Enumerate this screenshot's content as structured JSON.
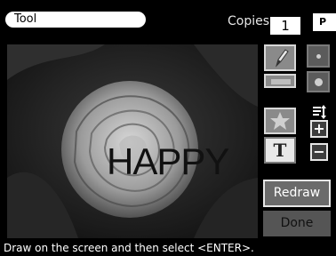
{
  "header": {
    "tool_label": "Tool",
    "copies_label": "Copies:",
    "copies_value": "1",
    "badge": "P"
  },
  "canvas": {
    "text_stamp": "HAPPY"
  },
  "sidebar": {
    "pen_icon": "pencil-icon",
    "size_small_icon": "small-dot-icon",
    "size_large_icon": "large-dot-icon",
    "stamp_icon": "star-icon",
    "text_button": "T",
    "plus": "+",
    "minus": "−",
    "redraw": "Redraw",
    "done": "Done"
  },
  "status": {
    "text": "Draw on the screen and then select <ENTER>."
  }
}
